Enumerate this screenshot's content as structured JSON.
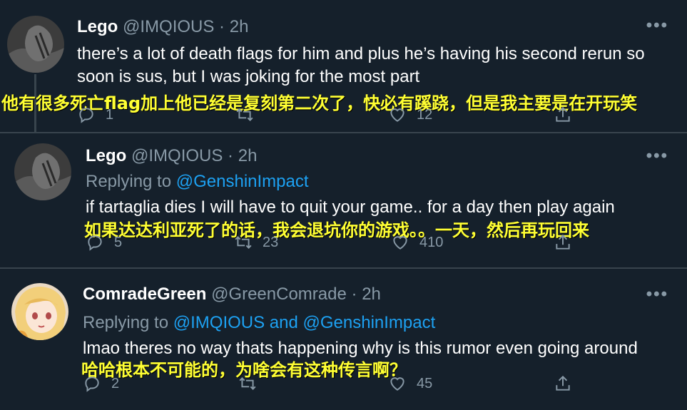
{
  "colors": {
    "background": "#15202b",
    "muted": "#8899a6",
    "link": "#1da1f2",
    "subtitle": "#ffff33",
    "divider": "#38444d"
  },
  "tweets": [
    {
      "author": {
        "name": "Lego",
        "handle": "@IMQIOUS",
        "time": "2h"
      },
      "more_label": "•••",
      "text": "there’s a lot of death flags for him and plus he’s having his second rerun so soon is sus, but I was joking for the most part",
      "subtitle": "他有很多死亡flag加上他已经是复刻第二次了，快必有蹊跷，但是我主要是在开玩笑",
      "stats": {
        "replies": "1",
        "retweets": "",
        "likes": "12"
      }
    },
    {
      "author": {
        "name": "Lego",
        "handle": "@IMQIOUS",
        "time": "2h"
      },
      "more_label": "•••",
      "replying_prefix": "Replying to ",
      "replying_to": "@GenshinImpact",
      "text": "if tartaglia dies I will have to quit your game.. for a day then play again",
      "subtitle": "如果达达利亚死了的话，我会退坑你的游戏。。一天，然后再玩回来",
      "stats": {
        "replies": "5",
        "retweets": "23",
        "likes": "410"
      }
    },
    {
      "author": {
        "name": "ComradeGreen",
        "handle": "@GreenComrade",
        "time": "2h"
      },
      "more_label": "•••",
      "replying_prefix": "Replying to ",
      "replying_to": "@IMQIOUS and @GenshinImpact",
      "text": "lmao theres no way thats happening why is this rumor even going around",
      "subtitle": "哈哈根本不可能的，为啥会有这种传言啊？",
      "stats": {
        "replies": "2",
        "retweets": "",
        "likes": "45"
      }
    }
  ]
}
